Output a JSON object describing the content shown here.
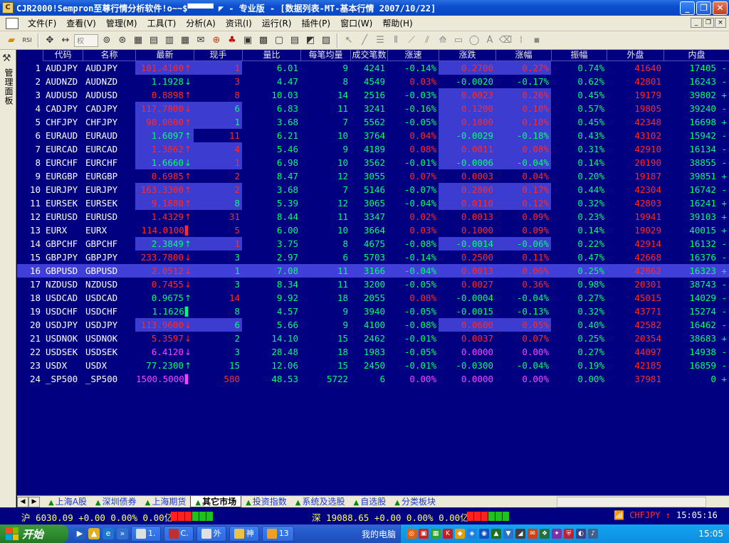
{
  "window": {
    "title": "CJR2000!Sempron至尊行情分析软件!o~~$▀▀▀▀▀ ◤  - 专业版 - [数据列表-MT-基本行情 2007/10/22]",
    "min_label": "_",
    "max_label": "❐",
    "close_label": "✕"
  },
  "menu": {
    "items": [
      "文件(F)",
      "查看(V)",
      "管理(M)",
      "工具(T)",
      "分析(A)",
      "资讯(I)",
      "运行(R)",
      "插件(P)",
      "窗口(W)",
      "帮助(H)"
    ],
    "mdi_buttons": [
      "_",
      "❐",
      "×"
    ]
  },
  "toolbar": {
    "select_label": "权"
  },
  "left_panel": {
    "label": "管理面板"
  },
  "headers": [
    "代码",
    "名称",
    "最新",
    "现手",
    "量比",
    "每笔均量",
    "成交笔数",
    "涨速",
    "涨跌",
    "涨幅",
    "振幅",
    "外盘",
    "内盘"
  ],
  "rows": [
    {
      "no": "1",
      "code": "AUDJPY",
      "name": "AUDJPY",
      "last": "101.4100",
      "arrow": "↑",
      "hand": "1",
      "vr": "6.01",
      "avg": "9",
      "cnt": "4241",
      "speed": "-0.14%",
      "chg": "0.2700",
      "pct": "0.27%",
      "amp": "0.74%",
      "outer": "41640",
      "inner": "17405 -"
    },
    {
      "no": "2",
      "code": "AUDNZD",
      "name": "AUDNZD",
      "last": "1.1928",
      "arrow": "↓",
      "hand": "3",
      "vr": "4.47",
      "avg": "8",
      "cnt": "4549",
      "speed": "0.03%",
      "chg": "-0.0020",
      "pct": "-0.17%",
      "amp": "0.62%",
      "outer": "42801",
      "inner": "16243 -"
    },
    {
      "no": "3",
      "code": "AUDUSD",
      "name": "AUDUSD",
      "last": "0.8898",
      "arrow": "↑",
      "hand": "8",
      "vr": "10.03",
      "avg": "14",
      "cnt": "2516",
      "speed": "-0.03%",
      "chg": "0.0023",
      "pct": "0.26%",
      "amp": "0.45%",
      "outer": "19179",
      "inner": "39802 +"
    },
    {
      "no": "4",
      "code": "CADJPY",
      "name": "CADJPY",
      "last": "117.7800",
      "arrow": "↓",
      "hand": "6",
      "vr": "6.83",
      "avg": "11",
      "cnt": "3241",
      "speed": "-0.16%",
      "chg": "0.1200",
      "pct": "0.10%",
      "amp": "0.57%",
      "outer": "19805",
      "inner": "39240 -"
    },
    {
      "no": "5",
      "code": "CHFJPY",
      "name": "CHFJPY",
      "last": "98.0000",
      "arrow": "↑",
      "hand": "1",
      "vr": "3.68",
      "avg": "7",
      "cnt": "5562",
      "speed": "-0.05%",
      "chg": "0.1800",
      "pct": "0.18%",
      "amp": "0.45%",
      "outer": "42348",
      "inner": "16698 +"
    },
    {
      "no": "6",
      "code": "EURAUD",
      "name": "EURAUD",
      "last": "1.6097",
      "arrow": "↑",
      "hand": "11",
      "vr": "6.21",
      "avg": "10",
      "cnt": "3764",
      "speed": "0.04%",
      "chg": "-0.0029",
      "pct": "-0.18%",
      "amp": "0.43%",
      "outer": "43102",
      "inner": "15942 -"
    },
    {
      "no": "7",
      "code": "EURCAD",
      "name": "EURCAD",
      "last": "1.3862",
      "arrow": "↑",
      "hand": "4",
      "vr": "5.46",
      "avg": "9",
      "cnt": "4189",
      "speed": "0.08%",
      "chg": "0.0011",
      "pct": "0.08%",
      "amp": "0.31%",
      "outer": "42910",
      "inner": "16134 -"
    },
    {
      "no": "8",
      "code": "EURCHF",
      "name": "EURCHF",
      "last": "1.6660",
      "arrow": "↓",
      "hand": "1",
      "vr": "6.98",
      "avg": "10",
      "cnt": "3562",
      "speed": "-0.01%",
      "chg": "-0.0006",
      "pct": "-0.04%",
      "amp": "0.14%",
      "outer": "20190",
      "inner": "38855 -"
    },
    {
      "no": "9",
      "code": "EURGBP",
      "name": "EURGBP",
      "last": "0.6985",
      "arrow": "↑",
      "hand": "2",
      "vr": "8.47",
      "avg": "12",
      "cnt": "3055",
      "speed": "0.07%",
      "chg": "0.0003",
      "pct": "0.04%",
      "amp": "0.20%",
      "outer": "19187",
      "inner": "39851 +"
    },
    {
      "no": "10",
      "code": "EURJPY",
      "name": "EURJPY",
      "last": "163.3300",
      "arrow": "↑",
      "hand": "2",
      "vr": "3.68",
      "avg": "7",
      "cnt": "5146",
      "speed": "-0.07%",
      "chg": "0.2800",
      "pct": "0.17%",
      "amp": "0.44%",
      "outer": "42304",
      "inner": "16742 -"
    },
    {
      "no": "11",
      "code": "EURSEK",
      "name": "EURSEK",
      "last": "9.1880",
      "arrow": "↑",
      "hand": "8",
      "vr": "5.39",
      "avg": "12",
      "cnt": "3065",
      "speed": "-0.04%",
      "chg": "0.0110",
      "pct": "0.12%",
      "amp": "0.32%",
      "outer": "42803",
      "inner": "16241 +"
    },
    {
      "no": "12",
      "code": "EURUSD",
      "name": "EURUSD",
      "last": "1.4329",
      "arrow": "↑",
      "hand": "31",
      "vr": "8.44",
      "avg": "11",
      "cnt": "3347",
      "speed": "0.02%",
      "chg": "0.0013",
      "pct": "0.09%",
      "amp": "0.23%",
      "outer": "19941",
      "inner": "39103 +"
    },
    {
      "no": "13",
      "code": "EURX",
      "name": "EURX",
      "last": "114.0100",
      "arrow": "▌",
      "hand": "5",
      "vr": "6.00",
      "avg": "10",
      "cnt": "3664",
      "speed": "0.03%",
      "chg": "0.1000",
      "pct": "0.09%",
      "amp": "0.14%",
      "outer": "19029",
      "inner": "40015 +"
    },
    {
      "no": "14",
      "code": "GBPCHF",
      "name": "GBPCHF",
      "last": "2.3849",
      "arrow": "↑",
      "hand": "1",
      "vr": "3.75",
      "avg": "8",
      "cnt": "4675",
      "speed": "-0.08%",
      "chg": "-0.0014",
      "pct": "-0.06%",
      "amp": "0.22%",
      "outer": "42914",
      "inner": "16132 -"
    },
    {
      "no": "15",
      "code": "GBPJPY",
      "name": "GBPJPY",
      "last": "233.7800",
      "arrow": "↓",
      "hand": "3",
      "vr": "2.97",
      "avg": "6",
      "cnt": "5703",
      "speed": "-0.14%",
      "chg": "0.2500",
      "pct": "0.11%",
      "amp": "0.47%",
      "outer": "42668",
      "inner": "16376 -"
    },
    {
      "no": "16",
      "code": "GBPUSD",
      "name": "GBPUSD",
      "last": "2.0512",
      "arrow": "↓",
      "hand": "1",
      "vr": "7.08",
      "avg": "11",
      "cnt": "3166",
      "speed": "-0.04%",
      "chg": "0.0013",
      "pct": "0.06%",
      "amp": "0.25%",
      "outer": "42862",
      "inner": "16323 +"
    },
    {
      "no": "17",
      "code": "NZDUSD",
      "name": "NZDUSD",
      "last": "0.7455",
      "arrow": "↓",
      "hand": "3",
      "vr": "8.34",
      "avg": "11",
      "cnt": "3200",
      "speed": "-0.05%",
      "chg": "0.0027",
      "pct": "0.36%",
      "amp": "0.98%",
      "outer": "20301",
      "inner": "38743 -"
    },
    {
      "no": "18",
      "code": "USDCAD",
      "name": "USDCAD",
      "last": "0.9675",
      "arrow": "↑",
      "hand": "14",
      "vr": "9.92",
      "avg": "18",
      "cnt": "2055",
      "speed": "0.08%",
      "chg": "-0.0004",
      "pct": "-0.04%",
      "amp": "0.27%",
      "outer": "45015",
      "inner": "14029 -"
    },
    {
      "no": "19",
      "code": "USDCHF",
      "name": "USDCHF",
      "last": "1.1626",
      "arrow": "▌",
      "hand": "8",
      "vr": "4.57",
      "avg": "9",
      "cnt": "3940",
      "speed": "-0.05%",
      "chg": "-0.0015",
      "pct": "-0.13%",
      "amp": "0.32%",
      "outer": "43771",
      "inner": "15274 -"
    },
    {
      "no": "20",
      "code": "USDJPY",
      "name": "USDJPY",
      "last": "113.9600",
      "arrow": "↓",
      "hand": "6",
      "vr": "5.66",
      "avg": "9",
      "cnt": "4100",
      "speed": "-0.08%",
      "chg": "0.0600",
      "pct": "0.05%",
      "amp": "0.40%",
      "outer": "42582",
      "inner": "16462 -"
    },
    {
      "no": "21",
      "code": "USDNOK",
      "name": "USDNOK",
      "last": "5.3597",
      "arrow": "↓",
      "hand": "2",
      "vr": "14.10",
      "avg": "15",
      "cnt": "2462",
      "speed": "-0.01%",
      "chg": "0.0037",
      "pct": "0.07%",
      "amp": "0.25%",
      "outer": "20354",
      "inner": "38683 +"
    },
    {
      "no": "22",
      "code": "USDSEK",
      "name": "USDSEK",
      "last": "6.4120",
      "arrow": "↓",
      "hand": "3",
      "vr": "28.48",
      "avg": "18",
      "cnt": "1983",
      "speed": "-0.05%",
      "chg": "0.0000",
      "pct": "0.00%",
      "amp": "0.27%",
      "outer": "44097",
      "inner": "14938 -"
    },
    {
      "no": "23",
      "code": "USDX",
      "name": "USDX",
      "last": "77.2300",
      "arrow": "↑",
      "hand": "15",
      "vr": "12.06",
      "avg": "15",
      "cnt": "2450",
      "speed": "-0.01%",
      "chg": "-0.0300",
      "pct": "-0.04%",
      "amp": "0.19%",
      "outer": "42185",
      "inner": "16859 -"
    },
    {
      "no": "24",
      "code": "_SP500",
      "name": "_SP500",
      "last": "1500.5000",
      "arrow": "▌",
      "hand": "580",
      "vr": "48.53",
      "avg": "5722",
      "cnt": "6",
      "speed": "0.00%",
      "chg": "0.0000",
      "pct": "0.00%",
      "amp": "0.00%",
      "outer": "37981",
      "inner": "0 +"
    }
  ],
  "row_styles": [
    {
      "last": "red",
      "last_hl": true,
      "hand": "red",
      "hand_hl": true,
      "speed": "green",
      "chg": "red",
      "chg_hl": true,
      "pct": "red",
      "pct_hl": true
    },
    {
      "last": "green",
      "last_hl": false,
      "hand": "red",
      "hand_hl": false,
      "speed": "red",
      "chg": "green",
      "chg_hl": false,
      "pct": "green",
      "pct_hl": false
    },
    {
      "last": "red",
      "last_hl": false,
      "hand": "red",
      "hand_hl": false,
      "speed": "green",
      "chg": "red",
      "chg_hl": true,
      "pct": "red",
      "pct_hl": true
    },
    {
      "last": "red",
      "last_hl": true,
      "hand": "green",
      "hand_hl": true,
      "speed": "green",
      "chg": "red",
      "chg_hl": true,
      "pct": "red",
      "pct_hl": true
    },
    {
      "last": "red",
      "last_hl": true,
      "hand": "green",
      "hand_hl": true,
      "speed": "green",
      "chg": "red",
      "chg_hl": true,
      "pct": "red",
      "pct_hl": true
    },
    {
      "last": "green",
      "last_hl": true,
      "hand": "red",
      "hand_hl": false,
      "speed": "red",
      "chg": "green",
      "chg_hl": true,
      "pct": "green",
      "pct_hl": true
    },
    {
      "last": "red",
      "last_hl": true,
      "hand": "red",
      "hand_hl": true,
      "speed": "red",
      "chg": "red",
      "chg_hl": true,
      "pct": "red",
      "pct_hl": true
    },
    {
      "last": "green",
      "last_hl": true,
      "hand": "red",
      "hand_hl": true,
      "speed": "green",
      "chg": "green",
      "chg_hl": true,
      "pct": "green",
      "pct_hl": true
    },
    {
      "last": "red",
      "last_hl": false,
      "hand": "red",
      "hand_hl": false,
      "speed": "red",
      "chg": "red",
      "chg_hl": false,
      "pct": "red",
      "pct_hl": false
    },
    {
      "last": "red",
      "last_hl": true,
      "hand": "red",
      "hand_hl": true,
      "speed": "green",
      "chg": "red",
      "chg_hl": true,
      "pct": "red",
      "pct_hl": true
    },
    {
      "last": "red",
      "last_hl": true,
      "hand": "green",
      "hand_hl": true,
      "speed": "green",
      "chg": "red",
      "chg_hl": true,
      "pct": "red",
      "pct_hl": true
    },
    {
      "last": "red",
      "last_hl": false,
      "hand": "red",
      "hand_hl": false,
      "speed": "red",
      "chg": "red",
      "chg_hl": false,
      "pct": "red",
      "pct_hl": false
    },
    {
      "last": "red",
      "last_hl": false,
      "hand": "red",
      "hand_hl": false,
      "speed": "red",
      "chg": "red",
      "chg_hl": false,
      "pct": "red",
      "pct_hl": false
    },
    {
      "last": "green",
      "last_hl": true,
      "hand": "red",
      "hand_hl": true,
      "speed": "green",
      "chg": "green",
      "chg_hl": true,
      "pct": "green",
      "pct_hl": true
    },
    {
      "last": "red",
      "last_hl": false,
      "hand": "green",
      "hand_hl": false,
      "speed": "green",
      "chg": "red",
      "chg_hl": false,
      "pct": "red",
      "pct_hl": false
    },
    {
      "last": "red",
      "last_hl": false,
      "hand": "green",
      "hand_hl": false,
      "speed": "green",
      "chg": "red",
      "chg_hl": false,
      "pct": "red",
      "pct_hl": false
    },
    {
      "last": "red",
      "last_hl": false,
      "hand": "green",
      "hand_hl": false,
      "speed": "green",
      "chg": "red",
      "chg_hl": false,
      "pct": "red",
      "pct_hl": false
    },
    {
      "last": "green",
      "last_hl": false,
      "hand": "red",
      "hand_hl": false,
      "speed": "red",
      "chg": "green",
      "chg_hl": false,
      "pct": "green",
      "pct_hl": false
    },
    {
      "last": "green",
      "last_hl": false,
      "hand": "green",
      "hand_hl": false,
      "speed": "green",
      "chg": "green",
      "chg_hl": false,
      "pct": "green",
      "pct_hl": false
    },
    {
      "last": "red",
      "last_hl": true,
      "hand": "green",
      "hand_hl": true,
      "speed": "green",
      "chg": "red",
      "chg_hl": true,
      "pct": "red",
      "pct_hl": true
    },
    {
      "last": "red",
      "last_hl": false,
      "hand": "green",
      "hand_hl": false,
      "speed": "green",
      "chg": "red",
      "chg_hl": false,
      "pct": "red",
      "pct_hl": false
    },
    {
      "last": "mag",
      "last_hl": false,
      "hand": "green",
      "hand_hl": false,
      "speed": "green",
      "chg": "mag",
      "chg_hl": false,
      "pct": "mag",
      "pct_hl": false
    },
    {
      "last": "green",
      "last_hl": false,
      "hand": "green",
      "hand_hl": false,
      "speed": "green",
      "chg": "green",
      "chg_hl": false,
      "pct": "green",
      "pct_hl": false
    },
    {
      "last": "mag",
      "last_hl": false,
      "hand": "red",
      "hand_hl": false,
      "speed": "mag",
      "chg": "mag",
      "chg_hl": false,
      "pct": "mag",
      "pct_hl": false
    }
  ],
  "selected_row": 15,
  "tabs": {
    "items": [
      "上海A股",
      "深圳债券",
      "上海期货",
      "其它市场",
      "投资指数",
      "系统及选股",
      "自选股",
      "分类板块"
    ],
    "active": 3,
    "prev_label": "◀",
    "next_label": "▶"
  },
  "status": {
    "sh_label": "沪",
    "sh_value": "6030.09 +0.00 0.00% 0.00亿",
    "sz_label": "深",
    "sz_value": "19088.65 +0.00 0.00% 0.00亿",
    "alert": "CHFJPY ↑",
    "time": "15:05:16"
  },
  "taskbar": {
    "start_label": "开始",
    "tasks": [
      "1.",
      "C.",
      "外",
      "神",
      "13"
    ],
    "my_computer": "我的电脑",
    "clock": "15:05"
  },
  "colors": {
    "grid_bg": "#000080",
    "up": "#ff2a2a",
    "down": "#00ff70",
    "flat": "#ff40ff",
    "highlight": "#3c3cd0",
    "selected_row": "#4040d8"
  }
}
